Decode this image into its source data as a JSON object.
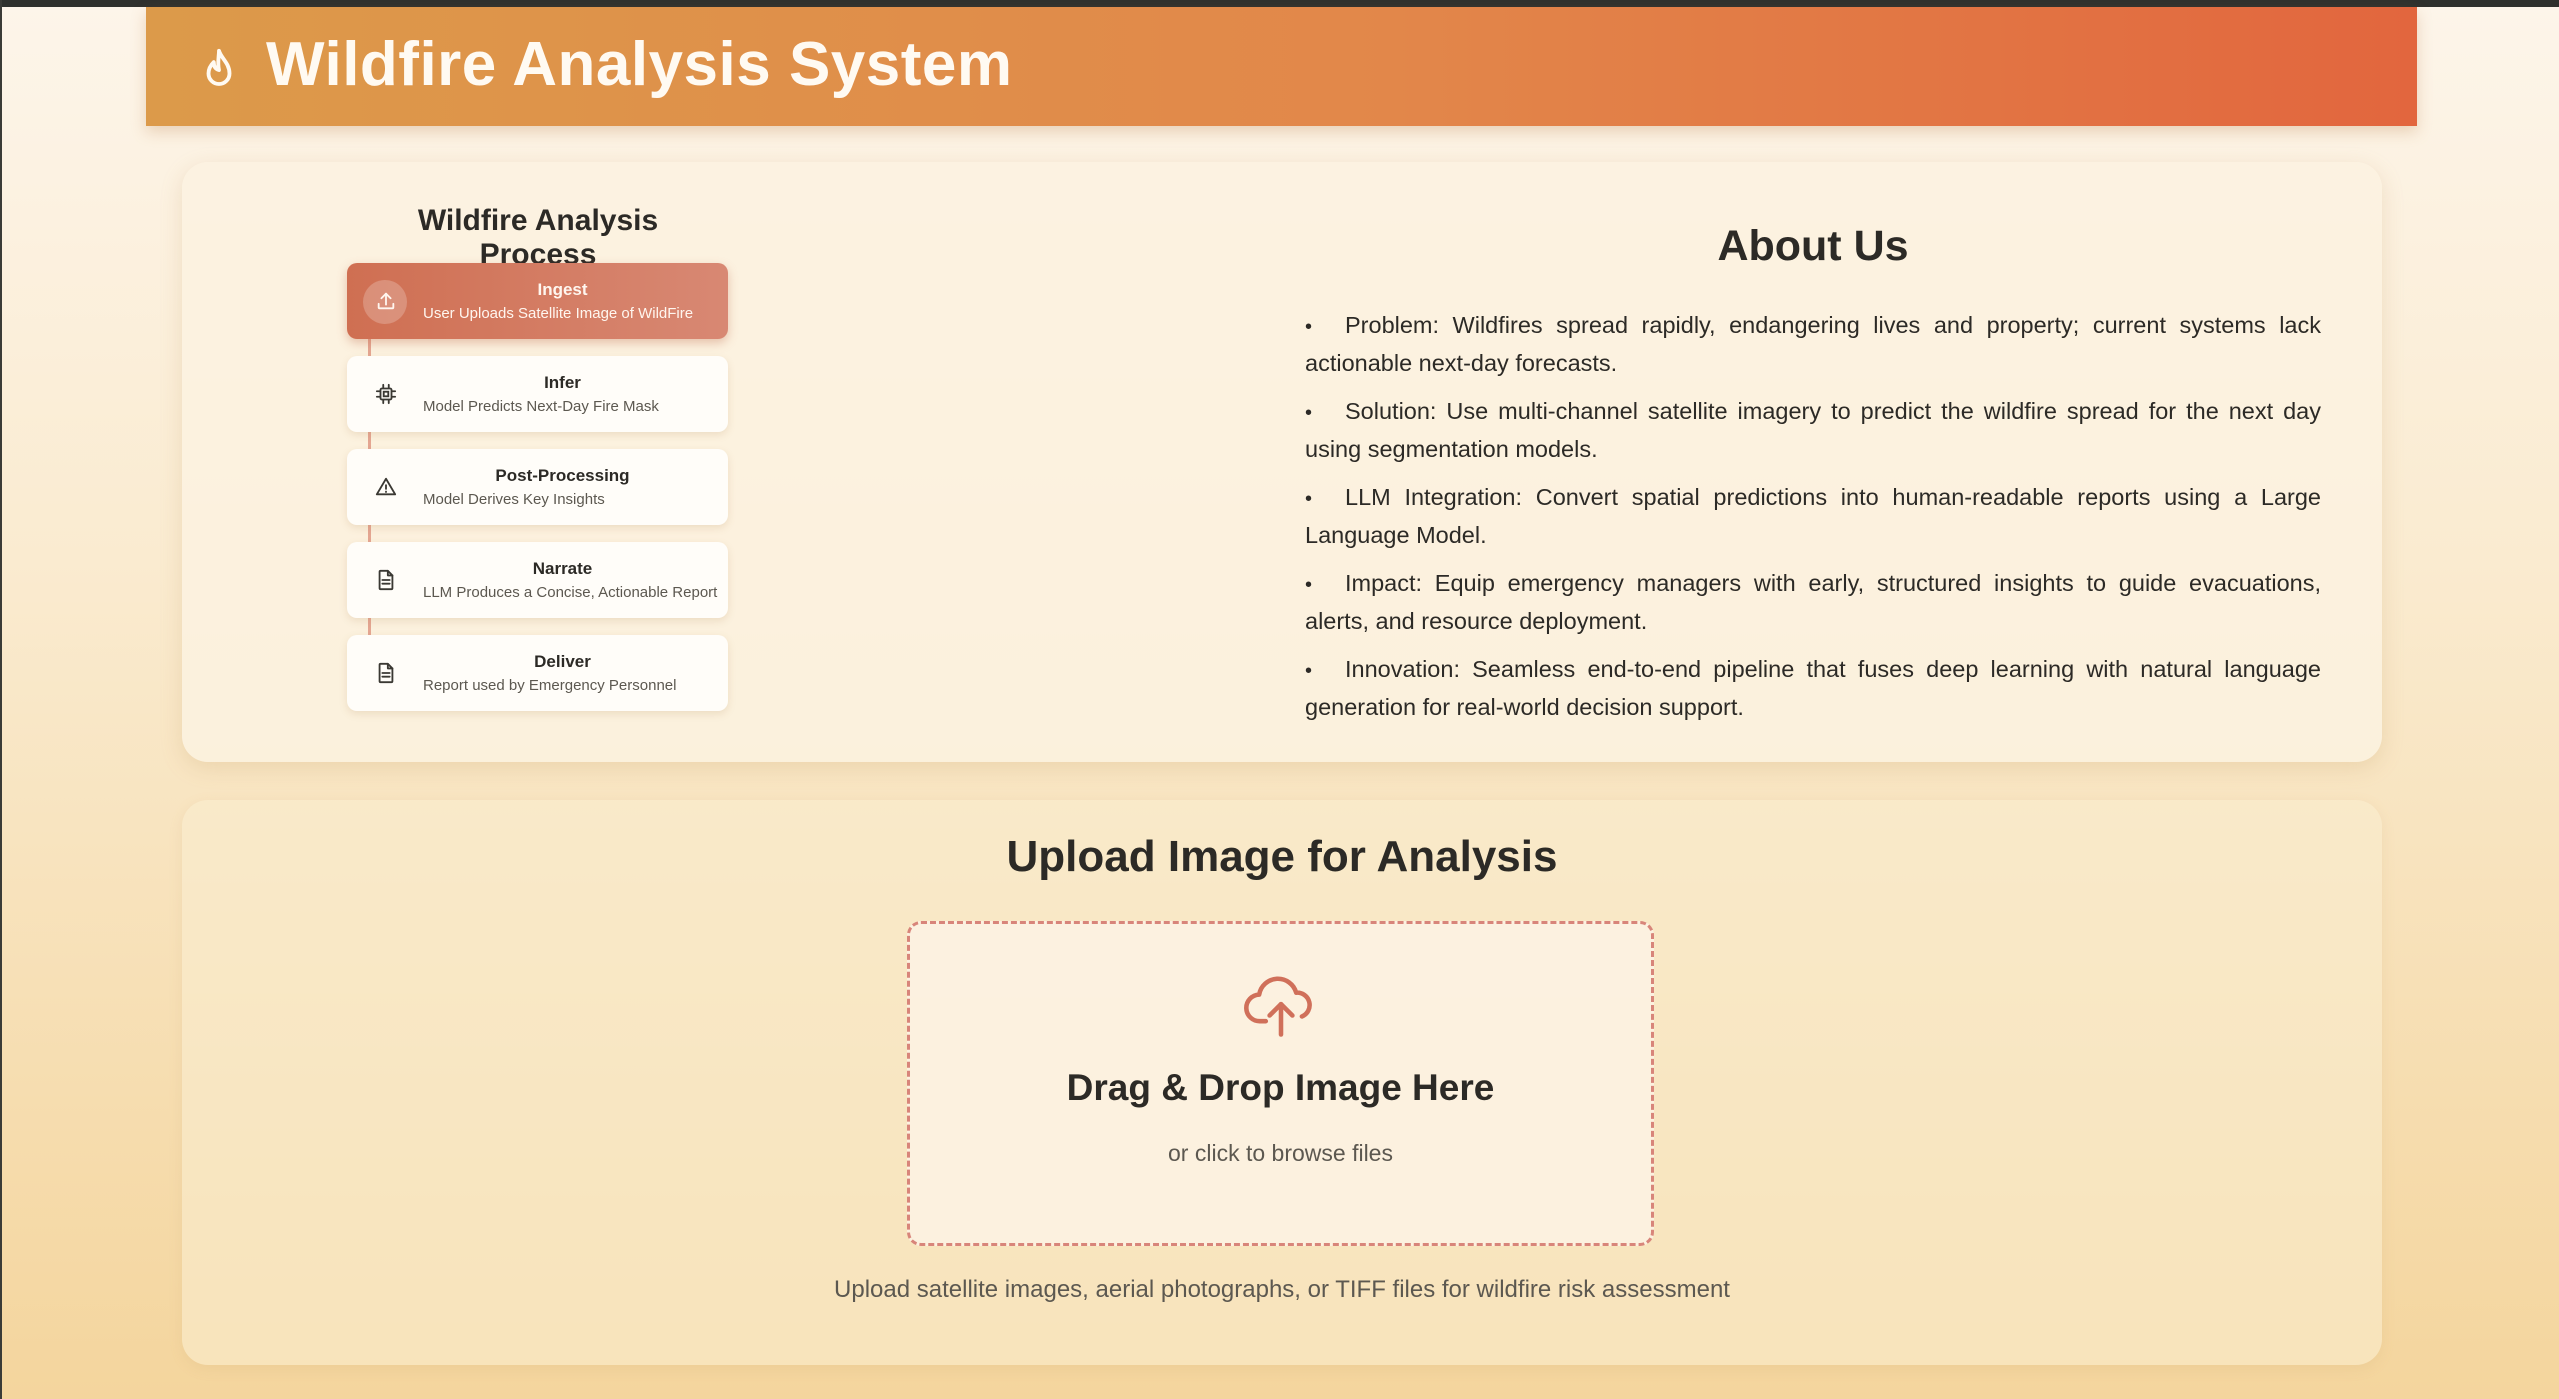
{
  "header": {
    "title": "Wildfire Analysis System",
    "icon": "flame-icon"
  },
  "process": {
    "title": "Wildfire Analysis Process",
    "steps": [
      {
        "title": "Ingest",
        "subtitle": "User Uploads Satellite Image of WildFire",
        "icon": "upload-icon",
        "active": true
      },
      {
        "title": "Infer",
        "subtitle": "Model Predicts Next-Day Fire Mask",
        "icon": "chip-icon",
        "active": false
      },
      {
        "title": "Post-Processing",
        "subtitle": "Model Derives Key Insights",
        "icon": "warning-icon",
        "active": false
      },
      {
        "title": "Narrate",
        "subtitle": "LLM Produces a Concise, Actionable Report",
        "icon": "document-icon",
        "active": false
      },
      {
        "title": "Deliver",
        "subtitle": "Report used by Emergency Personnel",
        "icon": "document-icon",
        "active": false
      }
    ]
  },
  "about": {
    "title": "About Us",
    "items": [
      "Problem: Wildfires spread rapidly, endangering lives and property; current systems lack actionable next-day forecasts.",
      "Solution: Use multi-channel satellite imagery to predict the wildfire spread for the next day using segmentation models.",
      "LLM Integration: Convert spatial predictions into human-readable reports using a Large Language Model.",
      "Impact: Equip emergency managers with early, structured insights to guide evacuations, alerts, and resource deployment.",
      "Innovation: Seamless end-to-end pipeline that fuses deep learning with natural language generation for real-world decision support."
    ]
  },
  "upload": {
    "title": "Upload Image for Analysis",
    "drop_title": "Drag & Drop Image Here",
    "drop_subtitle": "or click to browse files",
    "hint": "Upload satellite images, aerial photographs, or TIFF files for wildfire risk assessment",
    "icon": "cloud-upload-icon"
  },
  "colors": {
    "accent": "#d0705a",
    "header_start": "#dc9a4a",
    "header_end": "#e2663e",
    "dashed_border": "#d8857a"
  }
}
